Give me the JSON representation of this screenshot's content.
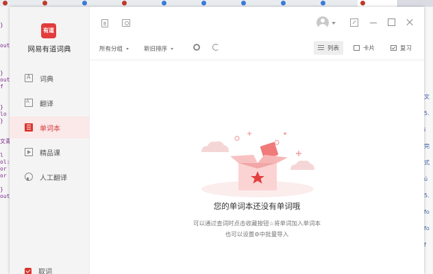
{
  "app": {
    "brand": "网易有道词典",
    "logo_text": "有道"
  },
  "sidebar": {
    "items": [
      {
        "label": "词典",
        "icon": "dictionary-icon",
        "active": false
      },
      {
        "label": "翻译",
        "icon": "translate-icon",
        "active": false
      },
      {
        "label": "单词本",
        "icon": "wordbook-icon",
        "active": true
      },
      {
        "label": "精品课",
        "icon": "course-icon",
        "active": false
      },
      {
        "label": "人工翻译",
        "icon": "human-translate-icon",
        "active": false
      }
    ],
    "cancel_label": "取词"
  },
  "toolbar": {
    "group_filter": "所有分组",
    "sort_order": "新旧排序",
    "views": [
      {
        "label": "列表",
        "icon": "list-icon",
        "active": true
      },
      {
        "label": "卡片",
        "icon": "card-icon",
        "active": false
      },
      {
        "label": "复习",
        "icon": "review-icon",
        "active": false
      }
    ]
  },
  "empty_state": {
    "title": "您的单词本还没有单词哦",
    "line1": "可以通过查词时点击收藏按钮☆将单词加入单词本",
    "line2": "也可以设置⚙中批量导入"
  },
  "background": {
    "code_glyphs": [
      "}",
      "out",
      "}",
      "out",
      "f",
      "}",
      "lo",
      "}",
      "文青",
      "l",
      "ol:",
      "or",
      "or",
      "}",
      "out"
    ],
    "right_glyphs": [
      "文",
      "5.",
      "i",
      "完",
      "式",
      "ú",
      "5.",
      "fo",
      "fo",
      "f"
    ]
  },
  "colors": {
    "accent": "#d9362f",
    "active_bg": "#fbe8e8"
  }
}
